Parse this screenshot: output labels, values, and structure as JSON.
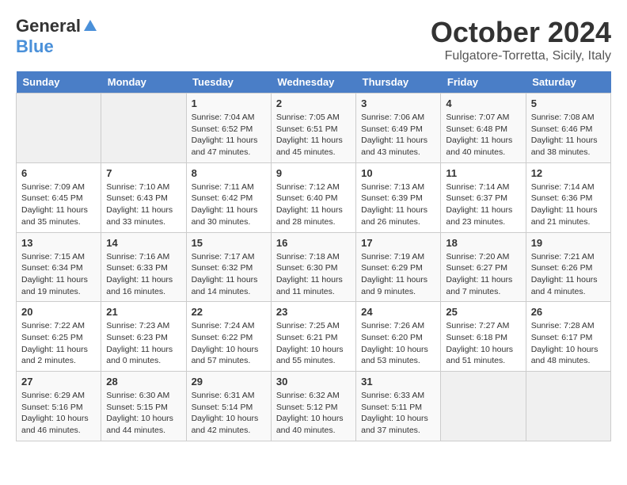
{
  "logo": {
    "general": "General",
    "blue": "Blue"
  },
  "title": "October 2024",
  "location": "Fulgatore-Torretta, Sicily, Italy",
  "days_of_week": [
    "Sunday",
    "Monday",
    "Tuesday",
    "Wednesday",
    "Thursday",
    "Friday",
    "Saturday"
  ],
  "weeks": [
    [
      {
        "day": "",
        "info": ""
      },
      {
        "day": "",
        "info": ""
      },
      {
        "day": "1",
        "info": "Sunrise: 7:04 AM\nSunset: 6:52 PM\nDaylight: 11 hours and 47 minutes."
      },
      {
        "day": "2",
        "info": "Sunrise: 7:05 AM\nSunset: 6:51 PM\nDaylight: 11 hours and 45 minutes."
      },
      {
        "day": "3",
        "info": "Sunrise: 7:06 AM\nSunset: 6:49 PM\nDaylight: 11 hours and 43 minutes."
      },
      {
        "day": "4",
        "info": "Sunrise: 7:07 AM\nSunset: 6:48 PM\nDaylight: 11 hours and 40 minutes."
      },
      {
        "day": "5",
        "info": "Sunrise: 7:08 AM\nSunset: 6:46 PM\nDaylight: 11 hours and 38 minutes."
      }
    ],
    [
      {
        "day": "6",
        "info": "Sunrise: 7:09 AM\nSunset: 6:45 PM\nDaylight: 11 hours and 35 minutes."
      },
      {
        "day": "7",
        "info": "Sunrise: 7:10 AM\nSunset: 6:43 PM\nDaylight: 11 hours and 33 minutes."
      },
      {
        "day": "8",
        "info": "Sunrise: 7:11 AM\nSunset: 6:42 PM\nDaylight: 11 hours and 30 minutes."
      },
      {
        "day": "9",
        "info": "Sunrise: 7:12 AM\nSunset: 6:40 PM\nDaylight: 11 hours and 28 minutes."
      },
      {
        "day": "10",
        "info": "Sunrise: 7:13 AM\nSunset: 6:39 PM\nDaylight: 11 hours and 26 minutes."
      },
      {
        "day": "11",
        "info": "Sunrise: 7:14 AM\nSunset: 6:37 PM\nDaylight: 11 hours and 23 minutes."
      },
      {
        "day": "12",
        "info": "Sunrise: 7:14 AM\nSunset: 6:36 PM\nDaylight: 11 hours and 21 minutes."
      }
    ],
    [
      {
        "day": "13",
        "info": "Sunrise: 7:15 AM\nSunset: 6:34 PM\nDaylight: 11 hours and 19 minutes."
      },
      {
        "day": "14",
        "info": "Sunrise: 7:16 AM\nSunset: 6:33 PM\nDaylight: 11 hours and 16 minutes."
      },
      {
        "day": "15",
        "info": "Sunrise: 7:17 AM\nSunset: 6:32 PM\nDaylight: 11 hours and 14 minutes."
      },
      {
        "day": "16",
        "info": "Sunrise: 7:18 AM\nSunset: 6:30 PM\nDaylight: 11 hours and 11 minutes."
      },
      {
        "day": "17",
        "info": "Sunrise: 7:19 AM\nSunset: 6:29 PM\nDaylight: 11 hours and 9 minutes."
      },
      {
        "day": "18",
        "info": "Sunrise: 7:20 AM\nSunset: 6:27 PM\nDaylight: 11 hours and 7 minutes."
      },
      {
        "day": "19",
        "info": "Sunrise: 7:21 AM\nSunset: 6:26 PM\nDaylight: 11 hours and 4 minutes."
      }
    ],
    [
      {
        "day": "20",
        "info": "Sunrise: 7:22 AM\nSunset: 6:25 PM\nDaylight: 11 hours and 2 minutes."
      },
      {
        "day": "21",
        "info": "Sunrise: 7:23 AM\nSunset: 6:23 PM\nDaylight: 11 hours and 0 minutes."
      },
      {
        "day": "22",
        "info": "Sunrise: 7:24 AM\nSunset: 6:22 PM\nDaylight: 10 hours and 57 minutes."
      },
      {
        "day": "23",
        "info": "Sunrise: 7:25 AM\nSunset: 6:21 PM\nDaylight: 10 hours and 55 minutes."
      },
      {
        "day": "24",
        "info": "Sunrise: 7:26 AM\nSunset: 6:20 PM\nDaylight: 10 hours and 53 minutes."
      },
      {
        "day": "25",
        "info": "Sunrise: 7:27 AM\nSunset: 6:18 PM\nDaylight: 10 hours and 51 minutes."
      },
      {
        "day": "26",
        "info": "Sunrise: 7:28 AM\nSunset: 6:17 PM\nDaylight: 10 hours and 48 minutes."
      }
    ],
    [
      {
        "day": "27",
        "info": "Sunrise: 6:29 AM\nSunset: 5:16 PM\nDaylight: 10 hours and 46 minutes."
      },
      {
        "day": "28",
        "info": "Sunrise: 6:30 AM\nSunset: 5:15 PM\nDaylight: 10 hours and 44 minutes."
      },
      {
        "day": "29",
        "info": "Sunrise: 6:31 AM\nSunset: 5:14 PM\nDaylight: 10 hours and 42 minutes."
      },
      {
        "day": "30",
        "info": "Sunrise: 6:32 AM\nSunset: 5:12 PM\nDaylight: 10 hours and 40 minutes."
      },
      {
        "day": "31",
        "info": "Sunrise: 6:33 AM\nSunset: 5:11 PM\nDaylight: 10 hours and 37 minutes."
      },
      {
        "day": "",
        "info": ""
      },
      {
        "day": "",
        "info": ""
      }
    ]
  ]
}
